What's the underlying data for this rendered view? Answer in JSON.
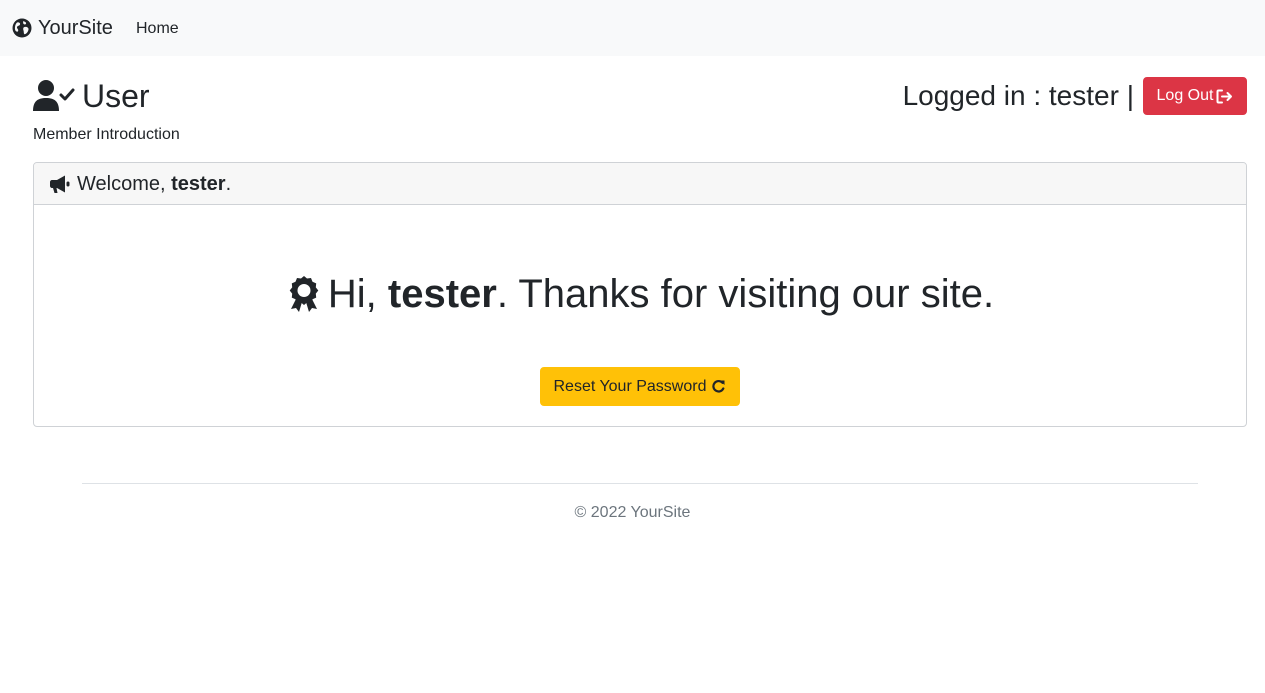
{
  "navbar": {
    "brand": "YourSite",
    "brand_icon": "globe-icon",
    "links": [
      "Home"
    ]
  },
  "header": {
    "title": "User",
    "title_icon": "user-check-icon",
    "subtitle": "Member Introduction",
    "login_status": "Logged in : tester |",
    "logout_label": "Log Out",
    "logout_icon": "sign-out-icon"
  },
  "card": {
    "header_icon": "megaphone-icon",
    "welcome_prefix": "Welcome, ",
    "username": "tester",
    "welcome_suffix": ".",
    "hero_icon": "award-icon",
    "hero_prefix": "Hi, ",
    "hero_suffix": ". Thanks for visiting our site.",
    "reset_label": "Reset Your Password",
    "reset_icon": "redo-icon"
  },
  "footer": {
    "text": "© 2022 YourSite"
  },
  "colors": {
    "navbar_bg": "#f8f9fa",
    "danger": "#dc3545",
    "warning": "#ffc107",
    "card_header_bg": "#f7f7f7"
  }
}
